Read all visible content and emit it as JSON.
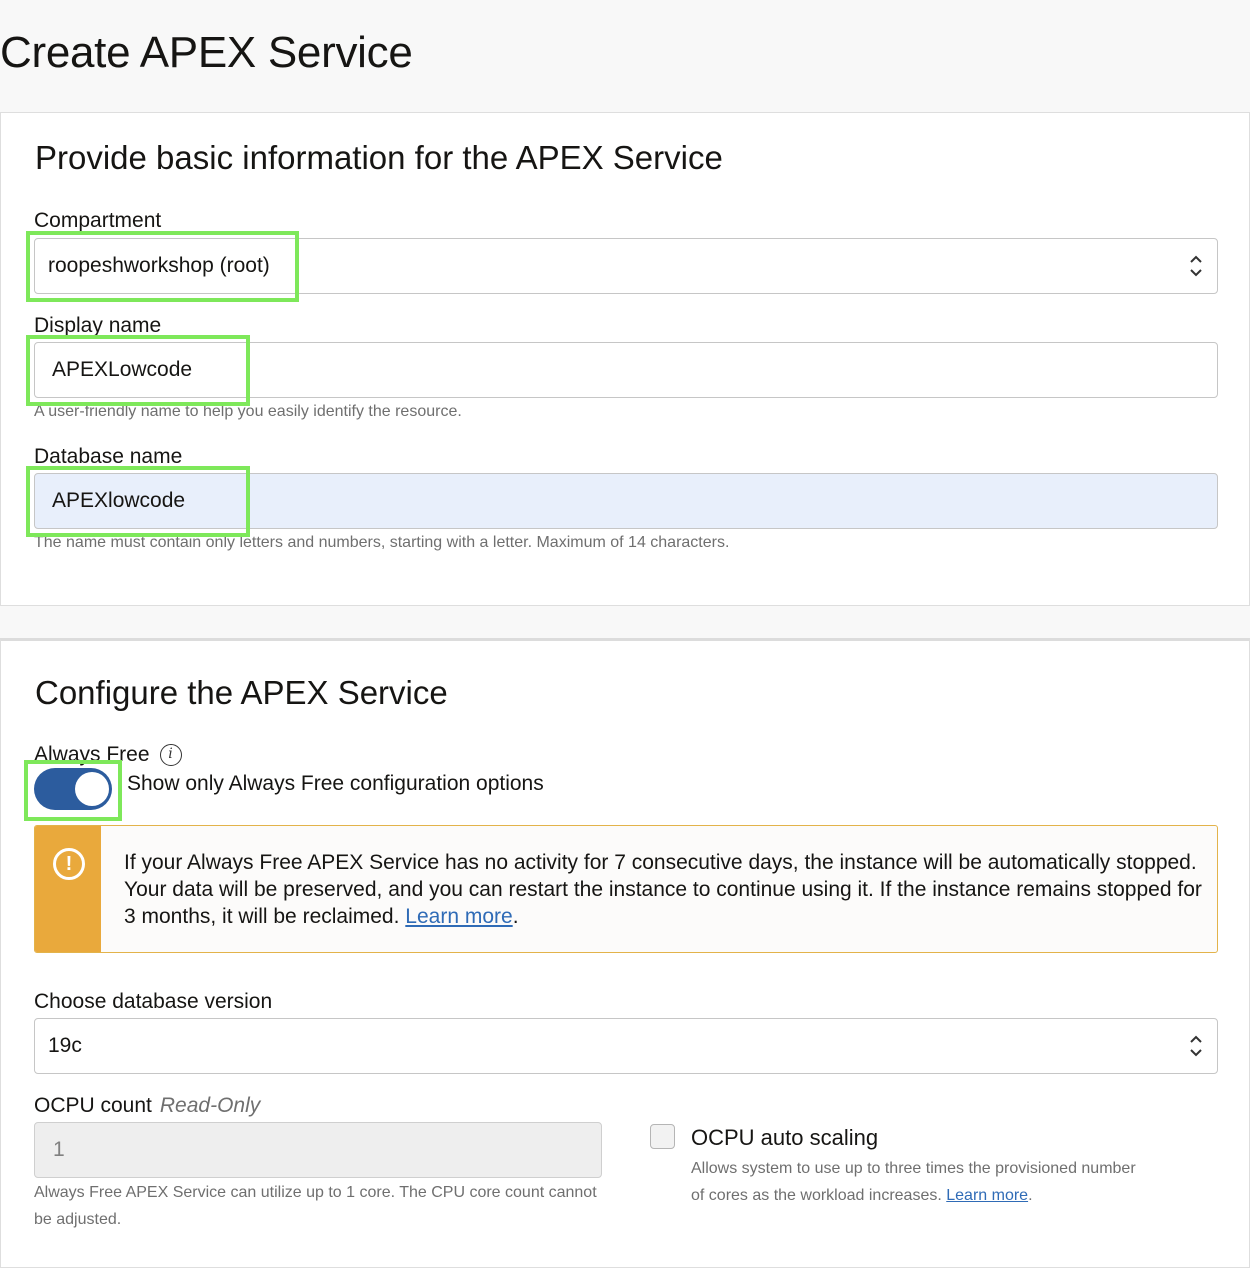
{
  "page": {
    "title": "Create APEX Service"
  },
  "basic": {
    "section_title": "Provide basic information for the APEX Service",
    "compartment": {
      "label": "Compartment",
      "value": "roopeshworkshop (root)"
    },
    "display_name": {
      "label": "Display name",
      "value": "APEXLowcode",
      "help": "A user-friendly name to help you easily identify the resource."
    },
    "database_name": {
      "label": "Database name",
      "value": "APEXlowcode",
      "help": "The name must contain only letters and numbers, starting with a letter. Maximum of 14 characters."
    }
  },
  "config": {
    "section_title": "Configure the APEX Service",
    "always_free": {
      "label": "Always Free",
      "info_icon": "info-icon",
      "toggle_on": true,
      "toggle_label": "Show only Always Free configuration options"
    },
    "banner": {
      "icon": "exclamation-circle-icon",
      "text": "If your Always Free APEX Service has no activity for 7 consecutive days, the instance will be automatically stopped. Your data will be preserved, and you can restart the instance to continue using it. If the instance remains stopped for 3 months, it will be reclaimed.",
      "link": "Learn more",
      "suffix": "."
    },
    "db_version": {
      "label": "Choose database version",
      "value": "19c"
    },
    "ocpu": {
      "label": "OCPU count",
      "tag": "Read-Only",
      "value": "1",
      "help": "Always Free APEX Service can utilize up to 1 core. The CPU core count cannot be adjusted."
    },
    "autoscaling": {
      "label": "OCPU auto scaling",
      "checked": false,
      "help": "Allows system to use up to three times the provisioned number of cores as the workload increases.",
      "link": "Learn more",
      "suffix": "."
    }
  },
  "colors": {
    "highlight": "#7ee85a",
    "toggle": "#2c5c9e",
    "warning": "#e9a93c",
    "link": "#2f6bb6"
  }
}
